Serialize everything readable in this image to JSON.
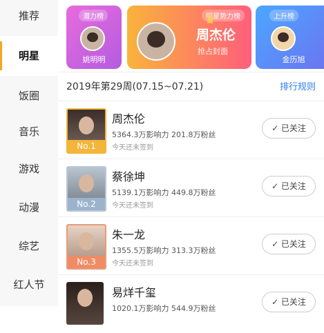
{
  "sidebar": {
    "items": [
      {
        "label": "推荐"
      },
      {
        "label": "明星"
      },
      {
        "label": "饭圈"
      },
      {
        "label": "音乐"
      },
      {
        "label": "游戏"
      },
      {
        "label": "动漫"
      },
      {
        "label": "综艺"
      },
      {
        "label": "红人节"
      }
    ],
    "active_index": 1
  },
  "banner": {
    "left": {
      "tag": "潜力榜",
      "name": "姚明明"
    },
    "center": {
      "tag": "明星势力榜",
      "name": "周杰伦",
      "subtitle": "抢占封面"
    },
    "right": {
      "tag": "上升榜",
      "name": "金历旭"
    }
  },
  "week": {
    "label": "2019年第29周(07.15~07.21)",
    "rules_link": "排行规则"
  },
  "ranking": [
    {
      "rank": "No.1",
      "name": "周杰伦",
      "stats": "5364.3万影响力 201.8万粉丝",
      "checkin": "今天还未签到",
      "follow": "✓ 已关注"
    },
    {
      "rank": "No.2",
      "name": "蔡徐坤",
      "stats": "5139.1万影响力 449.8万粉丝",
      "checkin": "今天还未签到",
      "follow": "✓ 已关注"
    },
    {
      "rank": "No.3",
      "name": "朱一龙",
      "stats": "1355.5万影响力 313.3万粉丝",
      "checkin": "今天还未签到",
      "follow": "✓ 已关注"
    },
    {
      "rank": "",
      "name": "易烊千玺",
      "stats": "1020.1万影响力 544.9万粉丝",
      "checkin": "",
      "follow": "✓ 已关注"
    }
  ],
  "colors": {
    "accent": "#f5a623",
    "link": "#2b7de9"
  }
}
